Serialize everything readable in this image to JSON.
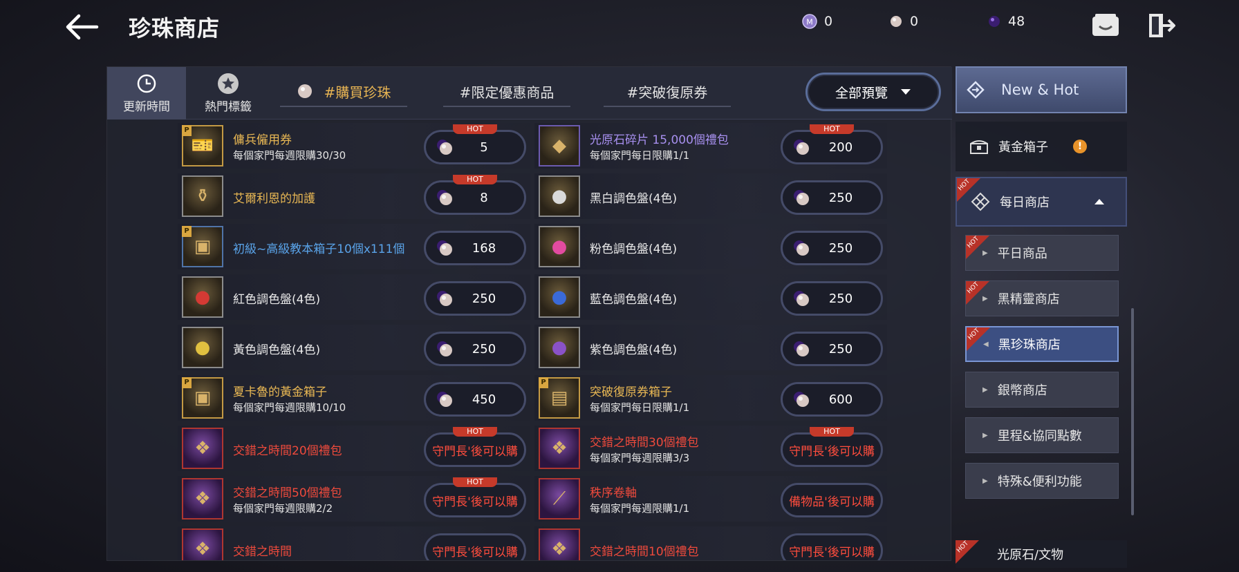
{
  "header": {
    "title": "珍珠商店",
    "currencies": [
      {
        "icon": "mileage-coin-icon",
        "value": "0"
      },
      {
        "icon": "pearl-icon",
        "value": "0"
      },
      {
        "icon": "black-pearl-icon",
        "value": "48"
      }
    ]
  },
  "tabs": {
    "side": [
      {
        "label": "更新時間",
        "icon": "clock-icon"
      },
      {
        "label": "熱門標籤",
        "icon": "star-icon"
      }
    ],
    "hashtags": [
      "#購買珍珠",
      "#限定優惠商品",
      "#突破復原券"
    ],
    "filter": "全部預覽"
  },
  "items": [
    {
      "name": "傭兵僱用券",
      "limit": "每個家門每週限購30/30",
      "price": "5",
      "hot": true,
      "color": "gold",
      "p": true,
      "icon": "ticket"
    },
    {
      "name": "光原石碎片 15,000個禮包",
      "limit": "每個家門每日限購1/1",
      "price": "200",
      "hot": true,
      "color": "violet",
      "p": false,
      "icon": "crystal"
    },
    {
      "name": "艾爾利恩的加護",
      "limit": "",
      "price": "8",
      "hot": true,
      "color": "gold",
      "p": false,
      "icon": "bottle"
    },
    {
      "name": "黑白調色盤(4色)",
      "limit": "",
      "price": "250",
      "hot": false,
      "color": "white",
      "p": false,
      "icon": "bucket-bw"
    },
    {
      "name": "初級~高級教本箱子10個x111個",
      "limit": "",
      "price": "168",
      "hot": false,
      "color": "blue",
      "p": true,
      "icon": "chest"
    },
    {
      "name": "粉色調色盤(4色)",
      "limit": "",
      "price": "250",
      "hot": false,
      "color": "white",
      "p": false,
      "icon": "bucket-pink"
    },
    {
      "name": "紅色調色盤(4色)",
      "limit": "",
      "price": "250",
      "hot": false,
      "color": "white",
      "p": false,
      "icon": "bucket-red"
    },
    {
      "name": "藍色調色盤(4色)",
      "limit": "",
      "price": "250",
      "hot": false,
      "color": "white",
      "p": false,
      "icon": "bucket-blue"
    },
    {
      "name": "黃色調色盤(4色)",
      "limit": "",
      "price": "250",
      "hot": false,
      "color": "white",
      "p": false,
      "icon": "bucket-yellow"
    },
    {
      "name": "紫色調色盤(4色)",
      "limit": "",
      "price": "250",
      "hot": false,
      "color": "white",
      "p": false,
      "icon": "bucket-purple"
    },
    {
      "name": "夏卡魯的黃金箱子",
      "limit": "每個家門每週限購10/10",
      "price": "450",
      "hot": false,
      "color": "gold",
      "p": true,
      "icon": "gold-chest"
    },
    {
      "name": "突破復原券箱子",
      "limit": "每個家門每日限購1/1",
      "price": "600",
      "hot": false,
      "color": "gold",
      "p": true,
      "icon": "box"
    },
    {
      "name": "交錯之時間20個禮包",
      "limit": "",
      "price": "守門長'後可以購",
      "hot": true,
      "color": "red",
      "p": false,
      "icon": "time",
      "locked": true
    },
    {
      "name": "交錯之時間30個禮包",
      "limit": "每個家門每週限購3/3",
      "price": "守門長'後可以購",
      "hot": true,
      "color": "red",
      "p": false,
      "icon": "time",
      "locked": true
    },
    {
      "name": "交錯之時間50個禮包",
      "limit": "每個家門每週限購2/2",
      "price": "守門長'後可以購",
      "hot": true,
      "color": "red",
      "p": false,
      "icon": "time",
      "locked": true
    },
    {
      "name": "秩序卷軸",
      "limit": "每個家門每週限購1/1",
      "price": "備物品'後可以購",
      "hot": false,
      "color": "red",
      "p": false,
      "icon": "scroll",
      "locked": true
    },
    {
      "name": "交錯之時間",
      "limit": "",
      "price": "守門長'後可以購",
      "hot": false,
      "color": "red",
      "p": false,
      "icon": "time",
      "locked": true
    },
    {
      "name": "交錯之時間10個禮包",
      "limit": "",
      "price": "守門長'後可以購",
      "hot": false,
      "color": "red",
      "p": false,
      "icon": "time",
      "locked": true
    }
  ],
  "rail": {
    "new_hot": "New & Hot",
    "gold_box": "黃金箱子",
    "alert": "!",
    "daily_shop": "每日商店",
    "hot_label": "HOT",
    "sub_items": [
      "平日商品",
      "黑精靈商店",
      "黑珍珠商店",
      "銀幣商店",
      "里程&協同點數",
      "特殊&便利功能"
    ],
    "last_cat": "光原石/文物"
  },
  "colors": {
    "gold": "#e9b854",
    "red": "#ee4a3c",
    "blue": "#5aa4ea",
    "violet": "#a890f0",
    "hot": "#c63a2a",
    "accent": "#5a6d9a"
  }
}
